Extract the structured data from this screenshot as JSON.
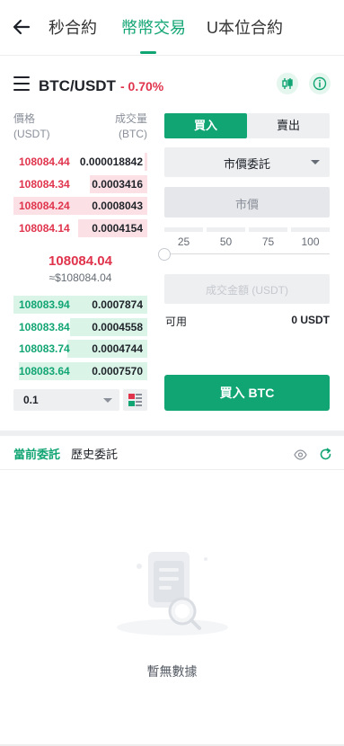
{
  "nav": {
    "tabs": [
      {
        "label": "秒合約"
      },
      {
        "label": "幣幣交易"
      },
      {
        "label": "U本位合約"
      }
    ],
    "active_tab": "幣幣交易"
  },
  "pair": {
    "symbol": "BTC/USDT",
    "change": "- 0.70%"
  },
  "orderbook": {
    "price_header": [
      "價格",
      "(USDT)"
    ],
    "qty_header": [
      "成交量",
      "(BTC)"
    ],
    "asks": [
      {
        "price": "108084.44",
        "qty": "0.000018842",
        "depth": 0.02
      },
      {
        "price": "108084.34",
        "qty": "0.0003416",
        "depth": 0.43
      },
      {
        "price": "108084.24",
        "qty": "0.0008043",
        "depth": 1.0
      },
      {
        "price": "108084.14",
        "qty": "0.0004154",
        "depth": 0.52
      }
    ],
    "last_price": "108084.04",
    "last_price_fiat": "≈$108084.04",
    "bids": [
      {
        "price": "108083.94",
        "qty": "0.0007874",
        "depth": 1.0
      },
      {
        "price": "108083.84",
        "qty": "0.0004558",
        "depth": 0.58
      },
      {
        "price": "108083.74",
        "qty": "0.0004744",
        "depth": 0.6
      },
      {
        "price": "108083.64",
        "qty": "0.0007570",
        "depth": 0.96
      }
    ],
    "precision": "0.1"
  },
  "form": {
    "buy_tab": "買入",
    "sell_tab": "賣出",
    "order_type": "市價委託",
    "price_placeholder": "市價",
    "percent_options": [
      "25",
      "50",
      "75",
      "100"
    ],
    "total_placeholder": "成交金額 (USDT)",
    "available_label": "可用",
    "available_value": "0 USDT",
    "submit_label": "買入 BTC"
  },
  "orders": {
    "tabs": [
      "當前委託",
      "歷史委託"
    ],
    "empty_text": "暫無數據"
  },
  "colors": {
    "accent": "#12a574",
    "down": "#e0344d"
  }
}
